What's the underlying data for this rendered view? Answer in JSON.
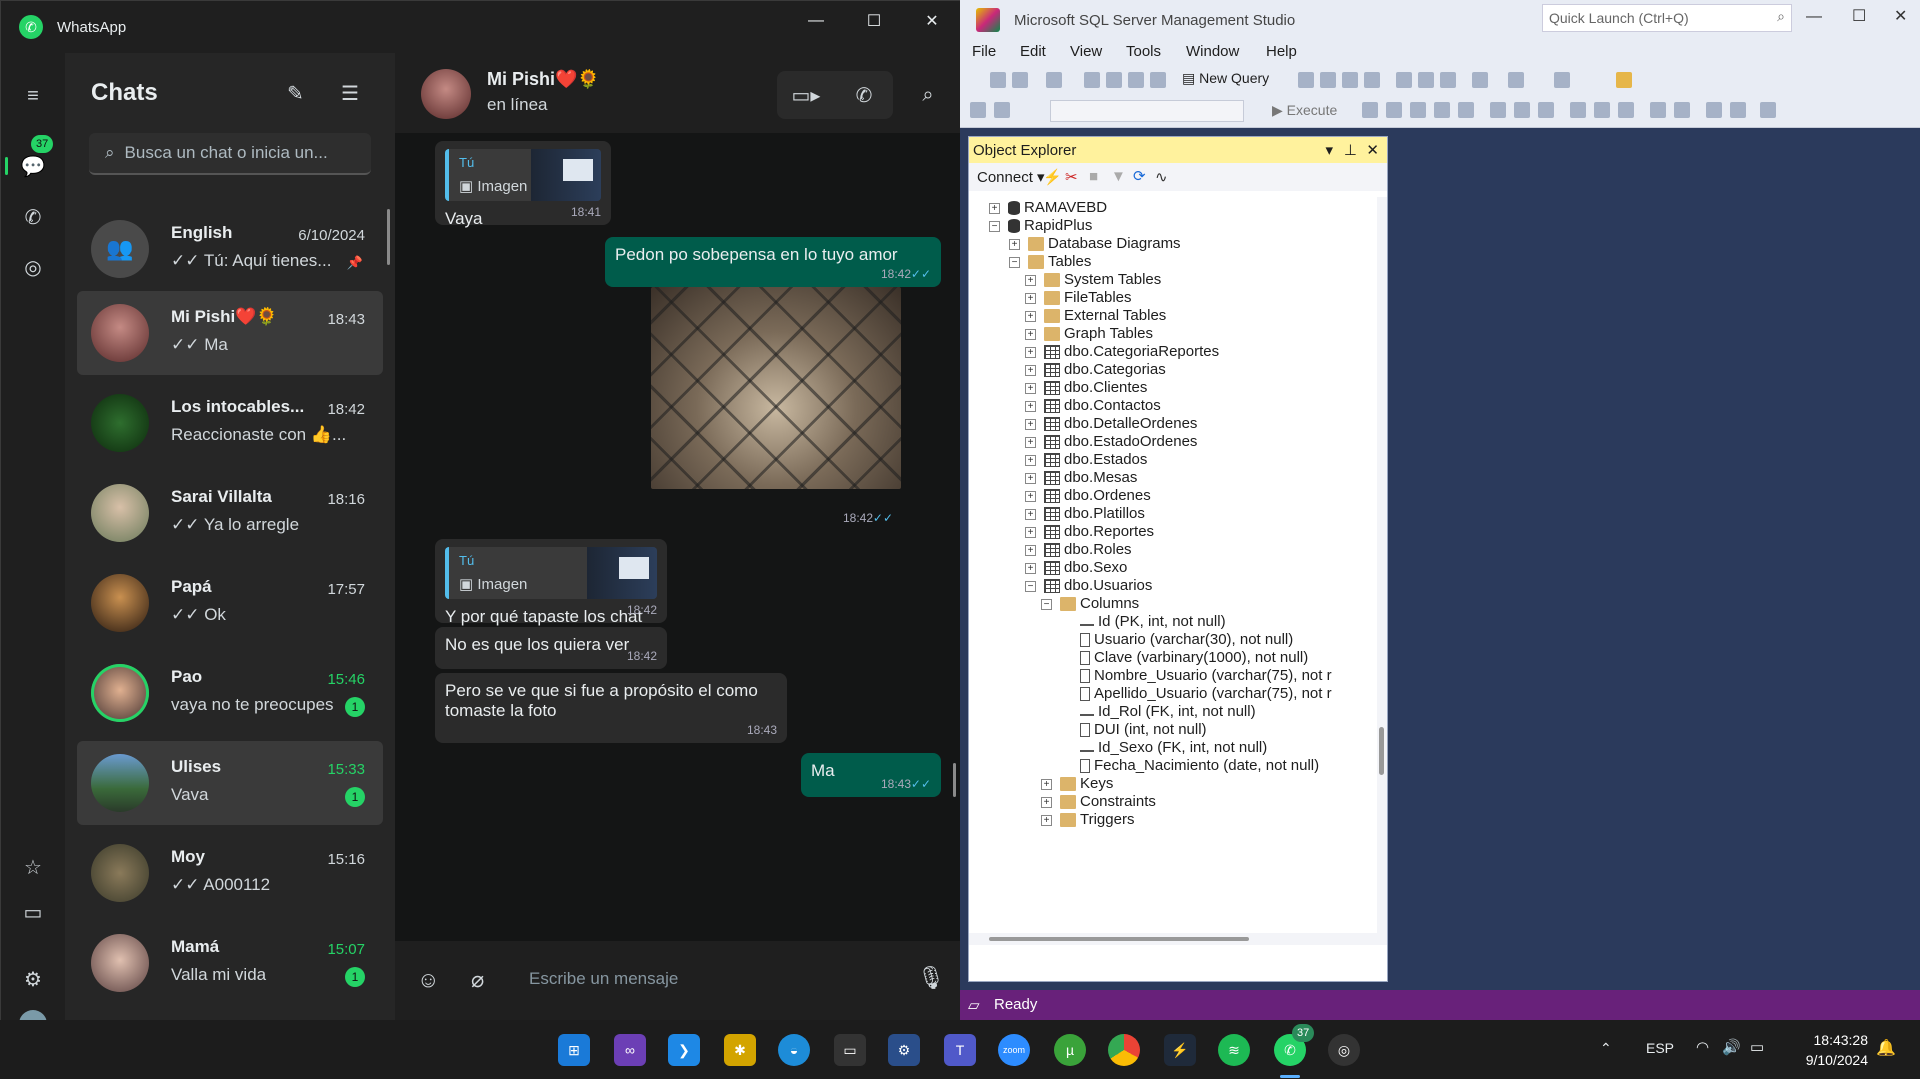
{
  "whatsapp": {
    "app_title": "WhatsApp",
    "rail_badge": "37",
    "list_title": "Chats",
    "search_placeholder": "Busca un chat o inicia un...",
    "chats": [
      {
        "name": "English",
        "time": "6/10/2024",
        "preview": "✓✓ Tú: Aquí tienes...",
        "unread": "",
        "avatar_color": "#4a4a4a"
      },
      {
        "name": "Mi Pishi❤️🌻",
        "time": "18:43",
        "preview": "✓✓ Ma",
        "unread": "",
        "avatar_color": "#7a3434"
      },
      {
        "name": "Los intocables...",
        "time": "18:42",
        "preview": "Reaccionaste con 👍...",
        "unread": "",
        "avatar_color": "#1e4a1e"
      },
      {
        "name": "Sarai Villalta",
        "time": "18:16",
        "preview": "✓✓ Ya lo arregle",
        "unread": "",
        "avatar_color": "#9b8a6a"
      },
      {
        "name": "Papá",
        "time": "17:57",
        "preview": "✓✓ Ok",
        "unread": "",
        "avatar_color": "#5a3e2a"
      },
      {
        "name": "Pao",
        "time": "15:46",
        "preview": "vaya no te preocupes",
        "unread": "1",
        "avatar_color": "#3b4a3b"
      },
      {
        "name": "Ulises",
        "time": "15:33",
        "preview": "Vava",
        "unread": "1",
        "avatar_color": "#4a6a8a"
      },
      {
        "name": "Moy",
        "time": "15:16",
        "preview": "✓✓ A000112",
        "unread": "",
        "avatar_color": "#5a5a3a"
      },
      {
        "name": "Mamá",
        "time": "15:07",
        "preview": "Valla mi vida",
        "unread": "1",
        "avatar_color": "#6a4a4a"
      }
    ],
    "conversation": {
      "contact": "Mi Pishi❤️🌻",
      "status": "en línea",
      "messages": {
        "m1_quote_who": "Tú",
        "m1_quote_kind": "Imagen",
        "m1_text": "Vaya",
        "m1_time": "18:41",
        "m2_text": "Pedon po sobepensa en lo tuyo amor",
        "m2_time": "18:42",
        "m3_time": "18:42",
        "m4_quote_who": "Tú",
        "m4_quote_kind": "Imagen",
        "m4_text": "Y por qué tapaste los chat",
        "m4_time": "18:42",
        "m5_text": "No es que los quiera ver",
        "m5_time": "18:42",
        "m6_text_1": "Pero se ve que si fue a propósito el como",
        "m6_text_2": "tomaste la foto",
        "m6_time": "18:43",
        "m7_text": "Ma",
        "m7_time": "18:43"
      },
      "compose_placeholder": "Escribe un mensaje"
    }
  },
  "ssms": {
    "title": "Microsoft SQL Server Management Studio",
    "quick_launch": "Quick Launch (Ctrl+Q)",
    "menu": [
      "File",
      "Edit",
      "View",
      "Tools",
      "Window",
      "Help"
    ],
    "new_query": "New Query",
    "execute": "Execute",
    "object_explorer": "Object Explorer",
    "connect": "Connect",
    "tree": [
      {
        "label": "RAMAVEBD",
        "level": 0,
        "exp": "+",
        "icon": "db"
      },
      {
        "label": "RapidPlus",
        "level": 0,
        "exp": "−",
        "icon": "db"
      },
      {
        "label": "Database Diagrams",
        "level": 1,
        "exp": "+",
        "icon": "fold"
      },
      {
        "label": "Tables",
        "level": 1,
        "exp": "−",
        "icon": "fold"
      },
      {
        "label": "System Tables",
        "level": 2,
        "exp": "+",
        "icon": "fold"
      },
      {
        "label": "FileTables",
        "level": 2,
        "exp": "+",
        "icon": "fold"
      },
      {
        "label": "External Tables",
        "level": 2,
        "exp": "+",
        "icon": "fold"
      },
      {
        "label": "Graph Tables",
        "level": 2,
        "exp": "+",
        "icon": "fold"
      },
      {
        "label": "dbo.CategoriaReportes",
        "level": 2,
        "exp": "+",
        "icon": "tbl"
      },
      {
        "label": "dbo.Categorias",
        "level": 2,
        "exp": "+",
        "icon": "tbl"
      },
      {
        "label": "dbo.Clientes",
        "level": 2,
        "exp": "+",
        "icon": "tbl"
      },
      {
        "label": "dbo.Contactos",
        "level": 2,
        "exp": "+",
        "icon": "tbl"
      },
      {
        "label": "dbo.DetalleOrdenes",
        "level": 2,
        "exp": "+",
        "icon": "tbl"
      },
      {
        "label": "dbo.EstadoOrdenes",
        "level": 2,
        "exp": "+",
        "icon": "tbl"
      },
      {
        "label": "dbo.Estados",
        "level": 2,
        "exp": "+",
        "icon": "tbl"
      },
      {
        "label": "dbo.Mesas",
        "level": 2,
        "exp": "+",
        "icon": "tbl"
      },
      {
        "label": "dbo.Ordenes",
        "level": 2,
        "exp": "+",
        "icon": "tbl"
      },
      {
        "label": "dbo.Platillos",
        "level": 2,
        "exp": "+",
        "icon": "tbl"
      },
      {
        "label": "dbo.Reportes",
        "level": 2,
        "exp": "+",
        "icon": "tbl"
      },
      {
        "label": "dbo.Roles",
        "level": 2,
        "exp": "+",
        "icon": "tbl"
      },
      {
        "label": "dbo.Sexo",
        "level": 2,
        "exp": "+",
        "icon": "tbl"
      },
      {
        "label": "dbo.Usuarios",
        "level": 2,
        "exp": "−",
        "icon": "tbl"
      },
      {
        "label": "Columns",
        "level": 3,
        "exp": "−",
        "icon": "fold"
      },
      {
        "label": "Id (PK, int, not null)",
        "level": 4,
        "exp": "",
        "icon": "key"
      },
      {
        "label": "Usuario (varchar(30), not null)",
        "level": 4,
        "exp": "",
        "icon": "col"
      },
      {
        "label": "Clave (varbinary(1000), not null)",
        "level": 4,
        "exp": "",
        "icon": "col"
      },
      {
        "label": "Nombre_Usuario (varchar(75), not r",
        "level": 4,
        "exp": "",
        "icon": "col"
      },
      {
        "label": "Apellido_Usuario (varchar(75), not r",
        "level": 4,
        "exp": "",
        "icon": "col"
      },
      {
        "label": "Id_Rol (FK, int, not null)",
        "level": 4,
        "exp": "",
        "icon": "key"
      },
      {
        "label": "DUI (int, not null)",
        "level": 4,
        "exp": "",
        "icon": "col"
      },
      {
        "label": "Id_Sexo (FK, int, not null)",
        "level": 4,
        "exp": "",
        "icon": "key"
      },
      {
        "label": "Fecha_Nacimiento (date, not null)",
        "level": 4,
        "exp": "",
        "icon": "col"
      },
      {
        "label": "Keys",
        "level": 3,
        "exp": "+",
        "icon": "fold"
      },
      {
        "label": "Constraints",
        "level": 3,
        "exp": "+",
        "icon": "fold"
      },
      {
        "label": "Triggers",
        "level": 3,
        "exp": "+",
        "icon": "fold"
      }
    ],
    "status": "Ready"
  },
  "taskbar": {
    "lang": "ESP",
    "time": "18:43:28",
    "date": "9/10/2024",
    "wa_badge": "37"
  }
}
